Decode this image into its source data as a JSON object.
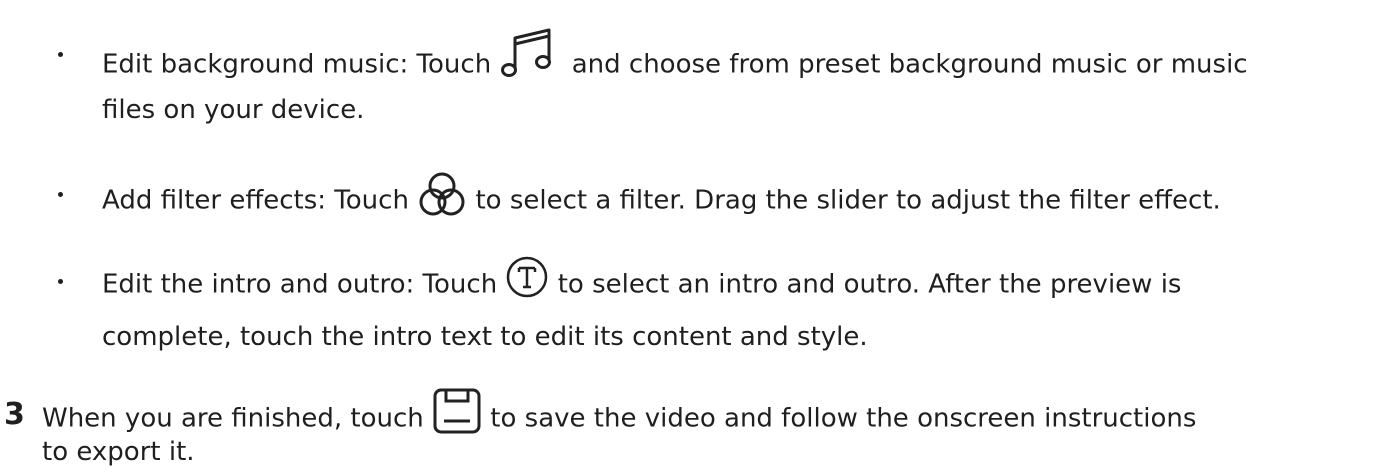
{
  "bullets": [
    {
      "before_icon": "Edit background music: Touch",
      "icon": "music-note-icon",
      "after_icon": "and choose from preset background music or music",
      "line2": "files on your device."
    },
    {
      "before_icon": "Add filter effects: Touch",
      "icon": "filter-icon",
      "after_icon": "to select a filter. Drag the slider to adjust the filter effect."
    },
    {
      "before_icon": "Edit the intro and outro: Touch",
      "icon": "text-t-icon",
      "after_icon": "to select an intro and outro. After the preview is",
      "line2": "complete, touch the intro text to edit its content and style."
    }
  ],
  "step": {
    "number": "3",
    "before_icon": "When you are finished, touch",
    "icon": "save-icon",
    "after_icon": "to save the video and follow the onscreen instructions",
    "line2": "to export it."
  }
}
